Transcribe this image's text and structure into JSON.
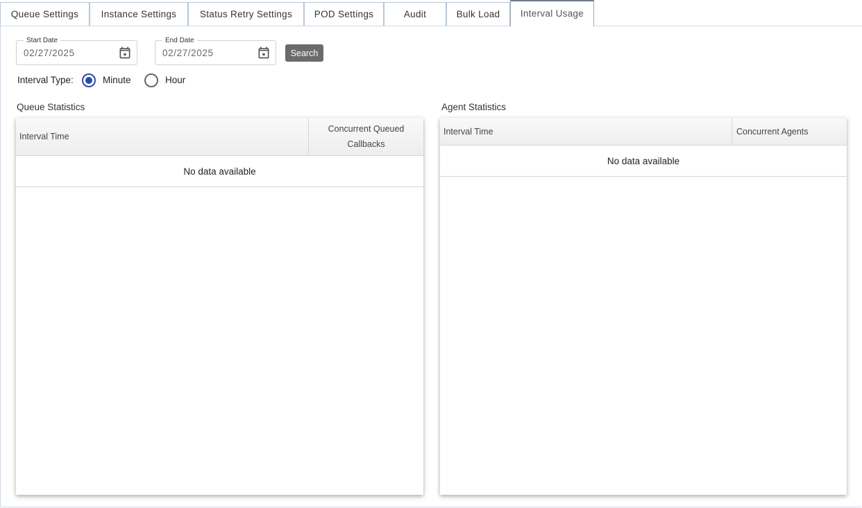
{
  "tabs": [
    {
      "label": "Queue Settings"
    },
    {
      "label": "Instance Settings"
    },
    {
      "label": "Status Retry Settings"
    },
    {
      "label": "POD Settings"
    },
    {
      "label": "Audit"
    },
    {
      "label": "Bulk Load"
    },
    {
      "label": "Interval Usage",
      "active": true
    }
  ],
  "filters": {
    "start_date": {
      "label": "Start Date",
      "value": "02/27/2025"
    },
    "end_date": {
      "label": "End Date",
      "value": "02/27/2025"
    },
    "search_label": "Search",
    "interval_type": {
      "label": "Interval Type:",
      "options": [
        "Minute",
        "Hour"
      ],
      "selected": "Minute"
    }
  },
  "queue_statistics": {
    "title": "Queue Statistics",
    "columns": [
      "Interval Time",
      "Concurrent Queued Callbacks"
    ],
    "empty_text": "No data available"
  },
  "agent_statistics": {
    "title": "Agent Statistics",
    "columns": [
      "Interval Time",
      "Concurrent Agents"
    ],
    "empty_text": "No data available"
  },
  "colors": {
    "accent": "#2b4aa8",
    "button": "#6b6b6b"
  }
}
